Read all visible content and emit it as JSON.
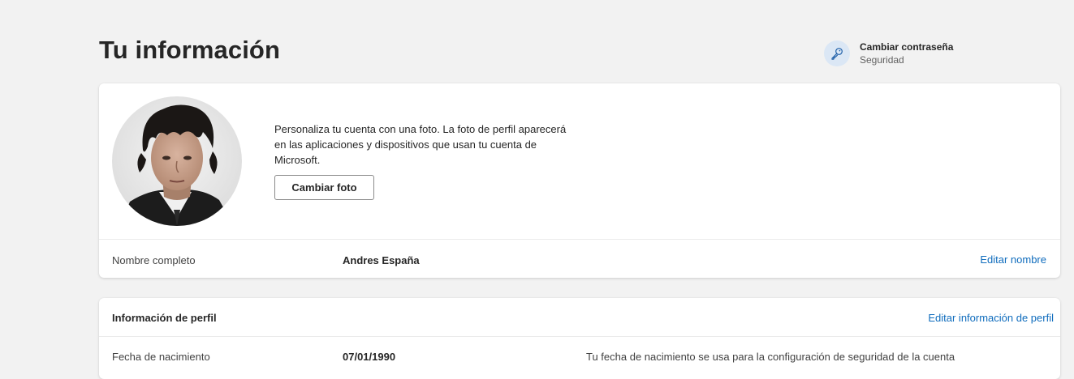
{
  "page": {
    "title": "Tu información"
  },
  "security": {
    "title": "Cambiar contraseña",
    "subtitle": "Seguridad",
    "icon": "key-icon"
  },
  "photo_card": {
    "description": "Personaliza tu cuenta con una foto. La foto de perfil aparecerá en las aplicaciones y dispositivos que usan tu cuenta de Microsoft.",
    "button_label": "Cambiar foto",
    "name_label": "Nombre completo",
    "name_value": "Andres España",
    "edit_name_label": "Editar nombre"
  },
  "profile_card": {
    "header": "Información de perfil",
    "edit_label": "Editar información de perfil",
    "rows": [
      {
        "label": "Fecha de nacimiento",
        "value": "07/01/1990",
        "note": "Tu fecha de nacimiento se usa para la configuración de seguridad de la cuenta"
      }
    ]
  },
  "colors": {
    "background": "#f2f2f2",
    "link": "#0f6cbd",
    "key_circle": "#dbe7f5"
  }
}
